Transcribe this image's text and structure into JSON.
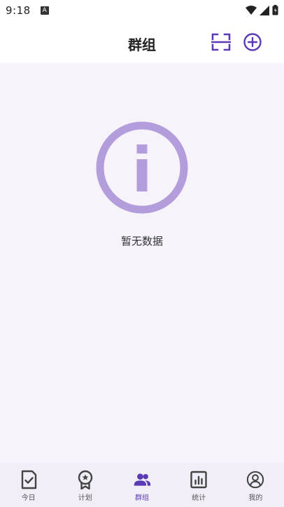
{
  "status_bar": {
    "time": "9:18",
    "notif_letter": "A"
  },
  "header": {
    "title": "群组"
  },
  "empty_state": {
    "text": "暂无数据"
  },
  "tabs": [
    {
      "label": "今日",
      "icon": "clipboard-check-icon",
      "active": false
    },
    {
      "label": "计划",
      "icon": "award-icon",
      "active": false
    },
    {
      "label": "群组",
      "icon": "group-icon",
      "active": true
    },
    {
      "label": "统计",
      "icon": "bar-chart-icon",
      "active": false
    },
    {
      "label": "我的",
      "icon": "user-circle-icon",
      "active": false
    }
  ],
  "colors": {
    "accent": "#5b3bb5",
    "empty_icon": "#b39ddb",
    "inactive_icon": "#444444",
    "background": "#f6f3fb"
  }
}
